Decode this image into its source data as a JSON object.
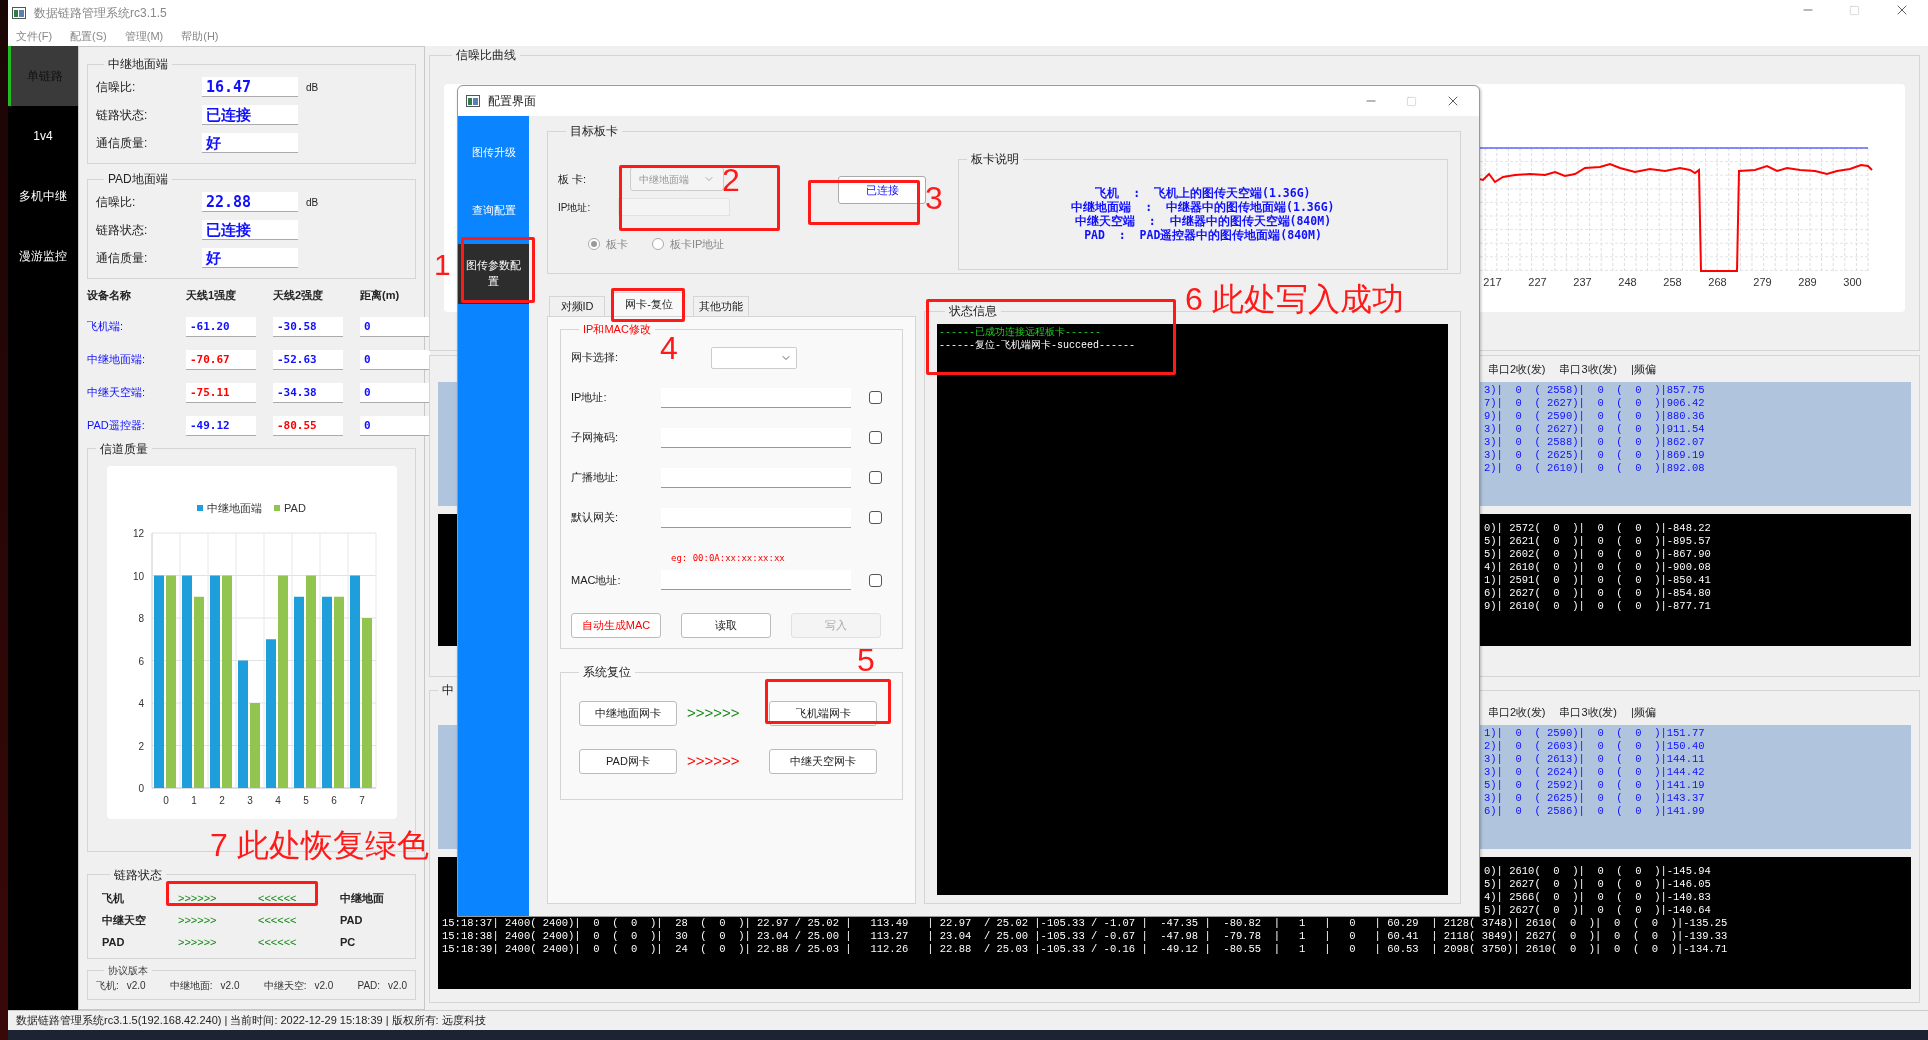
{
  "app": {
    "title": "数据链路管理系统rc3.1.5",
    "menu": [
      "文件(F)",
      "配置(S)",
      "管理(M)",
      "帮助(H)"
    ],
    "nav": [
      {
        "label": "单链路",
        "selected": true
      },
      {
        "label": "1v4",
        "selected": false
      },
      {
        "label": "多机中继",
        "selected": false
      },
      {
        "label": "漫游监控",
        "selected": false
      }
    ]
  },
  "left_panel": {
    "groups": [
      {
        "title": "中继地面端",
        "rows": [
          {
            "label": "信噪比:",
            "value": "16.47",
            "unit": "dB"
          },
          {
            "label": "链路状态:",
            "value": "已连接"
          },
          {
            "label": "通信质量:",
            "value": "好"
          }
        ]
      },
      {
        "title": "PAD地面端",
        "rows": [
          {
            "label": "信噪比:",
            "value": "22.88",
            "unit": "dB"
          },
          {
            "label": "链路状态:",
            "value": "已连接"
          },
          {
            "label": "通信质量:",
            "value": "好"
          }
        ]
      }
    ],
    "device_table": {
      "columns": [
        "设备名称",
        "天线1强度",
        "天线2强度",
        "距离(m)"
      ],
      "rows": [
        {
          "cells": [
            {
              "text": "飞机端:",
              "alert": false
            },
            {
              "text": "-61.20",
              "alert": false
            },
            {
              "text": "-30.58",
              "alert": false
            },
            {
              "text": "0",
              "alert": false
            }
          ]
        },
        {
          "cells": [
            {
              "text": "中继地面端:",
              "alert": false
            },
            {
              "text": "-70.67",
              "alert": true
            },
            {
              "text": "-52.63",
              "alert": false
            },
            {
              "text": "0",
              "alert": false
            }
          ]
        },
        {
          "cells": [
            {
              "text": "中继天空端:",
              "alert": false
            },
            {
              "text": "-75.11",
              "alert": true
            },
            {
              "text": "-34.38",
              "alert": false
            },
            {
              "text": "0",
              "alert": false
            }
          ]
        },
        {
          "cells": [
            {
              "text": "PAD遥控器:",
              "alert": false
            },
            {
              "text": "-49.12",
              "alert": false
            },
            {
              "text": "-80.55",
              "alert": true
            },
            {
              "text": "0",
              "alert": false
            }
          ]
        }
      ]
    },
    "channel_quality": {
      "title": "信道质量",
      "chart_data": {
        "type": "bar",
        "categories": [
          "0",
          "1",
          "2",
          "3",
          "4",
          "5",
          "6",
          "7"
        ],
        "series": [
          {
            "name": "中继地面端",
            "color": "#1e9fdb",
            "values": [
              10,
              10,
              10,
              6,
              7,
              9,
              9,
              10
            ]
          },
          {
            "name": "PAD",
            "color": "#92c54f",
            "values": [
              10,
              9,
              10,
              4,
              10,
              10,
              9,
              8
            ]
          }
        ],
        "ylim": [
          0,
          12
        ],
        "yticks": [
          0,
          2,
          4,
          6,
          8,
          10,
          12
        ],
        "grid": true,
        "legend": true
      }
    },
    "link_status": {
      "title": "链路状态",
      "rows": [
        {
          "left": "飞机",
          "forward": ">>>>>>",
          "back": "<<<<<<",
          "right": "中继地面",
          "ok": true
        },
        {
          "left": "中继天空",
          "forward": ">>>>>>",
          "back": "<<<<<<",
          "right": "PAD",
          "ok": true
        },
        {
          "left": "PAD",
          "forward": ">>>>>>",
          "back": "<<<<<<",
          "right": "PC",
          "ok": true
        }
      ]
    },
    "protocol": {
      "title": "协议版本",
      "items": [
        {
          "label": "飞机:",
          "value": "v2.0"
        },
        {
          "label": "中继地面:",
          "value": "v2.0"
        },
        {
          "label": "中继天空:",
          "value": "v2.0"
        },
        {
          "label": "PAD:",
          "value": "v2.0"
        }
      ]
    }
  },
  "snr_curve": {
    "title": "信噪比曲线",
    "x_labels": [
      "217",
      "227",
      "237",
      "248",
      "258",
      "268",
      "279",
      "289",
      "300"
    ]
  },
  "monitor_panels": [
    {
      "header": [
        "串口2收(发)",
        "串口3收(发)",
        "|频偏"
      ],
      "rx_rows": [
        "3)|  0  ( 2558)|  0  (  0  )|857.75",
        "7)|  0  ( 2627)|  0  (  0  )|906.42",
        "9)|  0  ( 2590)|  0  (  0  )|880.36",
        "3)|  0  ( 2627)|  0  (  0  )|911.54",
        "3)|  0  ( 2588)|  0  (  0  )|862.07",
        "3)|  0  ( 2625)|  0  (  0  )|869.19",
        "2)|  0  ( 2610)|  0  (  0  )|892.08"
      ],
      "tx_rows": [
        "0)| 2572(  0  )|  0  (  0  )|-848.22",
        "5)| 2621(  0  )|  0  (  0  )|-895.57",
        "5)| 2602(  0  )|  0  (  0  )|-867.90",
        "4)| 2610(  0  )|  0  (  0  )|-900.08",
        "1)| 2591(  0  )|  0  (  0  )|-850.41",
        "6)| 2627(  0  )|  0  (  0  )|-854.80",
        "9)| 2610(  0  )|  0  (  0  )|-877.71"
      ]
    },
    {
      "title": "中",
      "header": [
        "串口2收(发)",
        "串口3收(发)",
        "|频偏"
      ],
      "rx_rows": [
        "1)|  0  ( 2590)|  0  (  0  )|151.77",
        "2)|  0  ( 2603)|  0  (  0  )|150.40",
        "3)|  0  ( 2613)|  0  (  0  )|144.11",
        "3)|  0  ( 2624)|  0  (  0  )|144.42",
        "5)|  0  ( 2592)|  0  (  0  )|141.19",
        "3)|  0  ( 2625)|  0  (  0  )|143.37",
        "6)|  0  ( 2586)|  0  (  0  )|141.99"
      ],
      "tx_rows": [
        "0)| 2610(  0  )|  0  (  0  )|-145.94",
        "5)| 2627(  0  )|  0  (  0  )|-146.05",
        "4)| 2566(  0  )|  0  (  0  )|-140.83",
        "5)| 2627(  0  )|  0  (  0  )|-140.64"
      ],
      "full_rows": [
        "15:18:37| 2400( 2400)|  0  (  0  )|  28  (  0  )| 22.97 / 25.02 |   113.49   | 22.97  / 25.02 |-105.33 / -1.07 |  -47.35 |  -80.82  |   1   |   0   | 60.29  | 2128( 3748)| 2610(  0  )|  0  (  0  )|-135.25",
        "15:18:38| 2400( 2400)|  0  (  0  )|  30  (  0  )| 23.04 / 25.00 |   113.27   | 23.04  / 25.00 |-105.33 / -0.67 |  -47.98 |  -79.78  |   1   |   0   | 60.41  | 2118( 3849)| 2627(  0  )|  0  (  0  )|-139.33",
        "15:18:39| 2400( 2400)|  0  (  0  )|  24  (  0  )| 22.88 / 25.03 |   112.26   | 22.88  / 25.03 |-105.33 / -0.16 |  -49.12 |  -80.55  |   1   |   0   | 60.53  | 2098( 3750)| 2610(  0  )|  0  (  0  )|-134.71"
      ]
    }
  ],
  "dialog": {
    "title": "配置界面",
    "nav": [
      {
        "label": "图传升级",
        "selected": false
      },
      {
        "label": "查询配置",
        "selected": false
      },
      {
        "label": "图传参数配置",
        "selected": true
      }
    ],
    "target": {
      "title": "目标板卡",
      "card_label": "板  卡:",
      "card_value": "中继地面端",
      "ip_label": "IP地址:",
      "radios": [
        {
          "label": "板卡",
          "selected": true
        },
        {
          "label": "板卡IP地址",
          "selected": false
        }
      ],
      "connect_button": "已连接",
      "info_title": "板卡说明",
      "info_lines": [
        "飞机  :  飞机上的图传天空端(1.36G)",
        "中继地面端  :  中继器中的图传地面端(1.36G)",
        "中继天空端  :  中继器中的图传天空端(840M)",
        "PAD  :  PAD遥控器中的图传地面端(840M)"
      ]
    },
    "tabs": [
      {
        "label": "对频ID",
        "selected": false
      },
      {
        "label": "网卡-复位",
        "selected": true
      },
      {
        "label": "其他功能",
        "selected": false
      }
    ],
    "ip_mac": {
      "title": "IP和MAC修改",
      "nic_label": "网卡选择:",
      "fields": [
        {
          "label": "IP地址:",
          "checked": false
        },
        {
          "label": "子网掩码:",
          "checked": false
        },
        {
          "label": "广播地址:",
          "checked": false
        },
        {
          "label": "默认网关:",
          "checked": false
        }
      ],
      "hint": "eg: 00:0A:xx:xx:xx:xx",
      "mac": {
        "label": "MAC地址:",
        "checked": false
      },
      "buttons": [
        {
          "label": "自动生成MAC",
          "kind": "accent",
          "disabled": false
        },
        {
          "label": "读取",
          "kind": "normal",
          "disabled": false
        },
        {
          "label": "写入",
          "kind": "normal",
          "disabled": true
        }
      ]
    },
    "reset": {
      "title": "系统复位",
      "rows": [
        {
          "from": "中继地面网卡",
          "arrows": ">>>>>>",
          "ok": true,
          "to": "飞机端网卡"
        },
        {
          "from": "PAD网卡",
          "arrows": ">>>>>>",
          "ok": false,
          "to": "中继天空网卡"
        }
      ]
    },
    "status": {
      "title": "状态信息",
      "lines": [
        {
          "text": "------已成功连接远程板卡------",
          "kind": "success"
        },
        {
          "text": "------复位-飞机端网卡-succeed------",
          "kind": "plain"
        }
      ]
    }
  },
  "annotations": [
    {
      "kind": "box"
    },
    {
      "kind": "label",
      "text": "1"
    },
    {
      "kind": "box"
    },
    {
      "kind": "label",
      "text": "2"
    },
    {
      "kind": "box"
    },
    {
      "kind": "label",
      "text": "3"
    },
    {
      "kind": "box"
    },
    {
      "kind": "label",
      "text": "4"
    },
    {
      "kind": "box"
    },
    {
      "kind": "label",
      "text": "5"
    },
    {
      "kind": "box"
    },
    {
      "kind": "label",
      "text": "6 此处写入成功"
    },
    {
      "kind": "box"
    },
    {
      "kind": "label",
      "text": "7 此处恢复绿色"
    }
  ],
  "status_bar": "数据链路管理系统rc3.1.5(192.168.42.240) | 当前时间: 2022-12-29 15:18:39 | 版权所有: 远度科技"
}
